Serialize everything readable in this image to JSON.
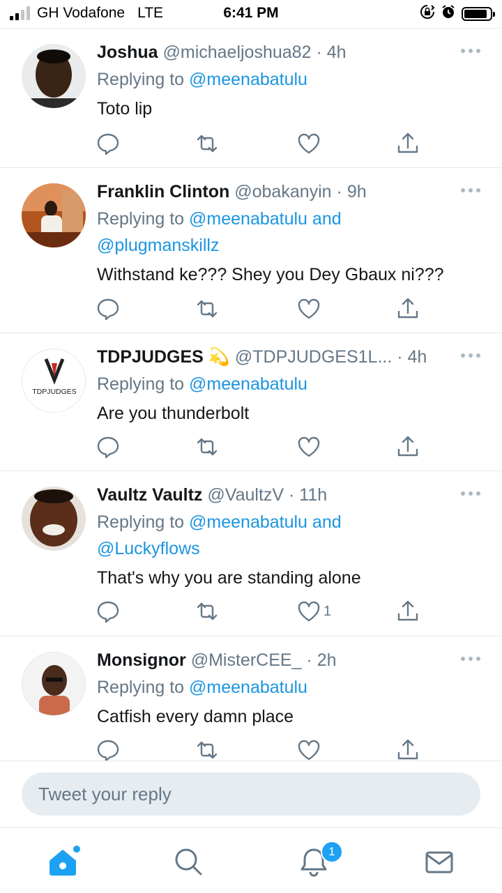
{
  "status_bar": {
    "carrier": "GH Vodafone",
    "network": "LTE",
    "time": "6:41 PM",
    "signal_bars_filled": 2,
    "signal_bars_total": 4,
    "battery_level": 0.9,
    "icons": [
      "orientation-lock-icon",
      "alarm-icon",
      "battery-icon"
    ]
  },
  "tweets": [
    {
      "name": "Joshua",
      "handle": "@michaeljoshua82",
      "time": "· 4h",
      "reply_prefix": "Replying to ",
      "reply_to": "@meenabatulu",
      "reply_to_2": "",
      "text": "Toto lip",
      "likes": ""
    },
    {
      "name": "Franklin Clinton",
      "handle": "@obakanyin",
      "time": "· 9h",
      "reply_prefix": "Replying to ",
      "reply_to": "@meenabatulu and",
      "reply_to_2": "@plugmanskillz",
      "text": "Withstand ke??? Shey you Dey Gbaux ni???",
      "likes": ""
    },
    {
      "name": "TDPJUDGES",
      "emoji": "💫",
      "handle": "@TDPJUDGES1L...",
      "time": "· 4h",
      "reply_prefix": "Replying to ",
      "reply_to": "@meenabatulu",
      "reply_to_2": "",
      "text": "Are you thunderbolt",
      "likes": "",
      "avatar_logo_text": "TDPJUDGES"
    },
    {
      "name": "Vaultz Vaultz",
      "handle": "@VaultzV",
      "time": "· 11h",
      "reply_prefix": "Replying to ",
      "reply_to": "@meenabatulu and",
      "reply_to_2": "@Luckyflows",
      "text": "That's why you are standing alone",
      "likes": "1"
    },
    {
      "name": "Monsignor",
      "handle": "@MisterCEE_",
      "time": "· 2h",
      "reply_prefix": "Replying to ",
      "reply_to": "@meenabatulu",
      "reply_to_2": "",
      "text": "Catfish every damn place",
      "likes": ""
    }
  ],
  "reply_box": {
    "placeholder": "Tweet your reply"
  },
  "tab_bar": {
    "items": [
      "home-icon",
      "search-icon",
      "notifications-icon",
      "messages-icon"
    ],
    "notifications_badge": "1",
    "accent": "#1da1f2"
  },
  "colors": {
    "link": "#1b95e0",
    "muted": "#657786",
    "text": "#14171a"
  }
}
